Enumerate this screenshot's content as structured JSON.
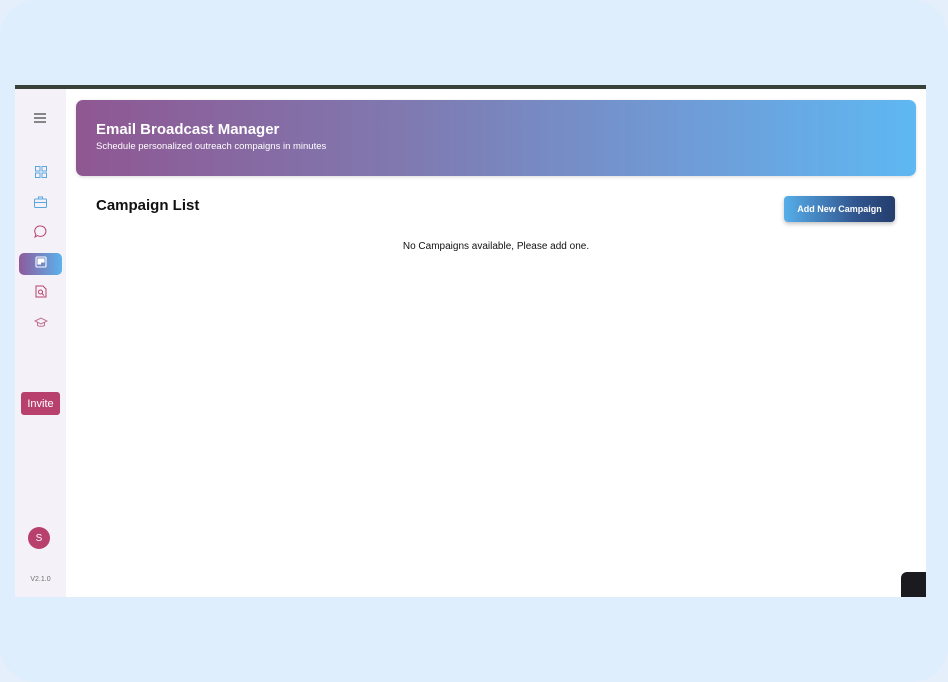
{
  "banner": {
    "title": "Email Broadcast Manager",
    "subtitle": "Schedule personalized outreach compaigns in minutes"
  },
  "sidebar": {
    "menu_icon": "hamburger-menu-icon",
    "items": [
      {
        "icon": "dashboard-grid-icon",
        "active": false
      },
      {
        "icon": "briefcase-icon",
        "active": false
      },
      {
        "icon": "chat-bubble-icon",
        "active": false
      },
      {
        "icon": "campaign-board-icon",
        "active": true
      },
      {
        "icon": "document-search-icon",
        "active": false
      },
      {
        "icon": "graduation-cap-icon",
        "active": false
      }
    ],
    "invite_label": "Invite",
    "avatar_initial": "S",
    "version": "V2.1.0"
  },
  "main": {
    "section_title": "Campaign List",
    "add_button_label": "Add New Campaign",
    "empty_message": "No Campaigns available, Please add one."
  },
  "colors": {
    "accent_pink": "#b8406c",
    "gradient_start": "#8f5792",
    "gradient_end": "#5eb8f2",
    "button_dark": "#243d6d"
  }
}
